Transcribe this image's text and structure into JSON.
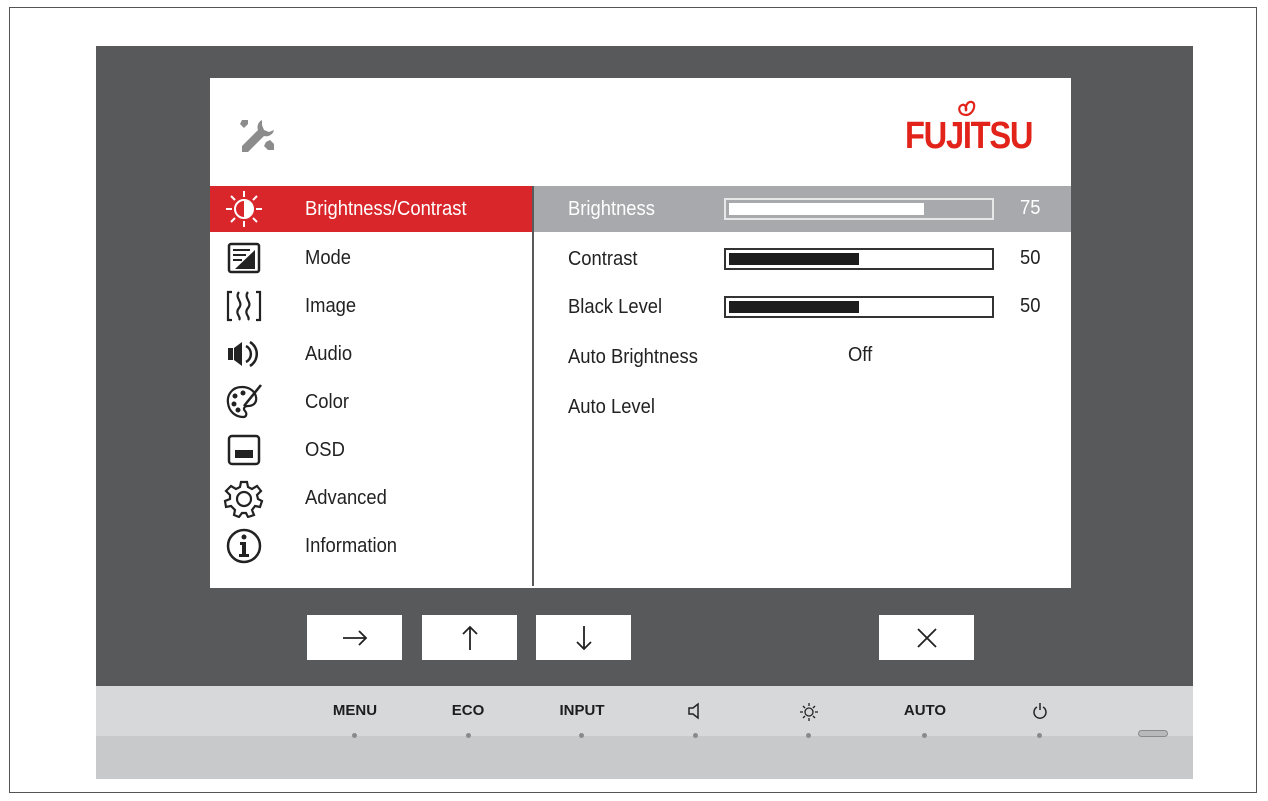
{
  "brand": {
    "logo_text": "FUJITSU",
    "color": "#e2231a"
  },
  "osd": {
    "header_icon": "tools-icon",
    "menu": [
      {
        "label": "Brightness/Contrast",
        "icon": "brightness-contrast-icon",
        "active": true
      },
      {
        "label": "Mode",
        "icon": "mode-icon",
        "active": false
      },
      {
        "label": "Image",
        "icon": "image-icon",
        "active": false
      },
      {
        "label": "Audio",
        "icon": "speaker-icon",
        "active": false
      },
      {
        "label": "Color",
        "icon": "palette-icon",
        "active": false
      },
      {
        "label": "OSD",
        "icon": "osd-icon",
        "active": false
      },
      {
        "label": "Advanced",
        "icon": "gear-icon",
        "active": false
      },
      {
        "label": "Information",
        "icon": "info-icon",
        "active": false
      }
    ],
    "settings": [
      {
        "label": "Brightness",
        "type": "slider",
        "value": 75,
        "display": "75",
        "active": true
      },
      {
        "label": "Contrast",
        "type": "slider",
        "value": 50,
        "display": "50",
        "active": false
      },
      {
        "label": "Black Level",
        "type": "slider",
        "value": 50,
        "display": "50",
        "active": false
      },
      {
        "label": "Auto Brightness",
        "type": "option",
        "display": "Off",
        "active": false
      },
      {
        "label": "Auto Level",
        "type": "action",
        "active": false
      }
    ],
    "nav_buttons": [
      {
        "symbol": "→",
        "icon": "arrow-right-icon"
      },
      {
        "symbol": "↑",
        "icon": "arrow-up-icon"
      },
      {
        "symbol": "↓",
        "icon": "arrow-down-icon"
      },
      {
        "symbol": "×",
        "icon": "close-icon"
      }
    ]
  },
  "front_panel": {
    "buttons": [
      {
        "label": "MENU"
      },
      {
        "label": "ECO"
      },
      {
        "label": "INPUT"
      },
      {
        "label": "",
        "icon": "speaker-icon"
      },
      {
        "label": "",
        "icon": "brightness-icon"
      },
      {
        "label": "AUTO"
      },
      {
        "label": "",
        "icon": "power-icon"
      }
    ]
  },
  "colors": {
    "accent": "#d9262b",
    "bezel": "#58595b",
    "highlight_row": "#a7a9ac"
  }
}
